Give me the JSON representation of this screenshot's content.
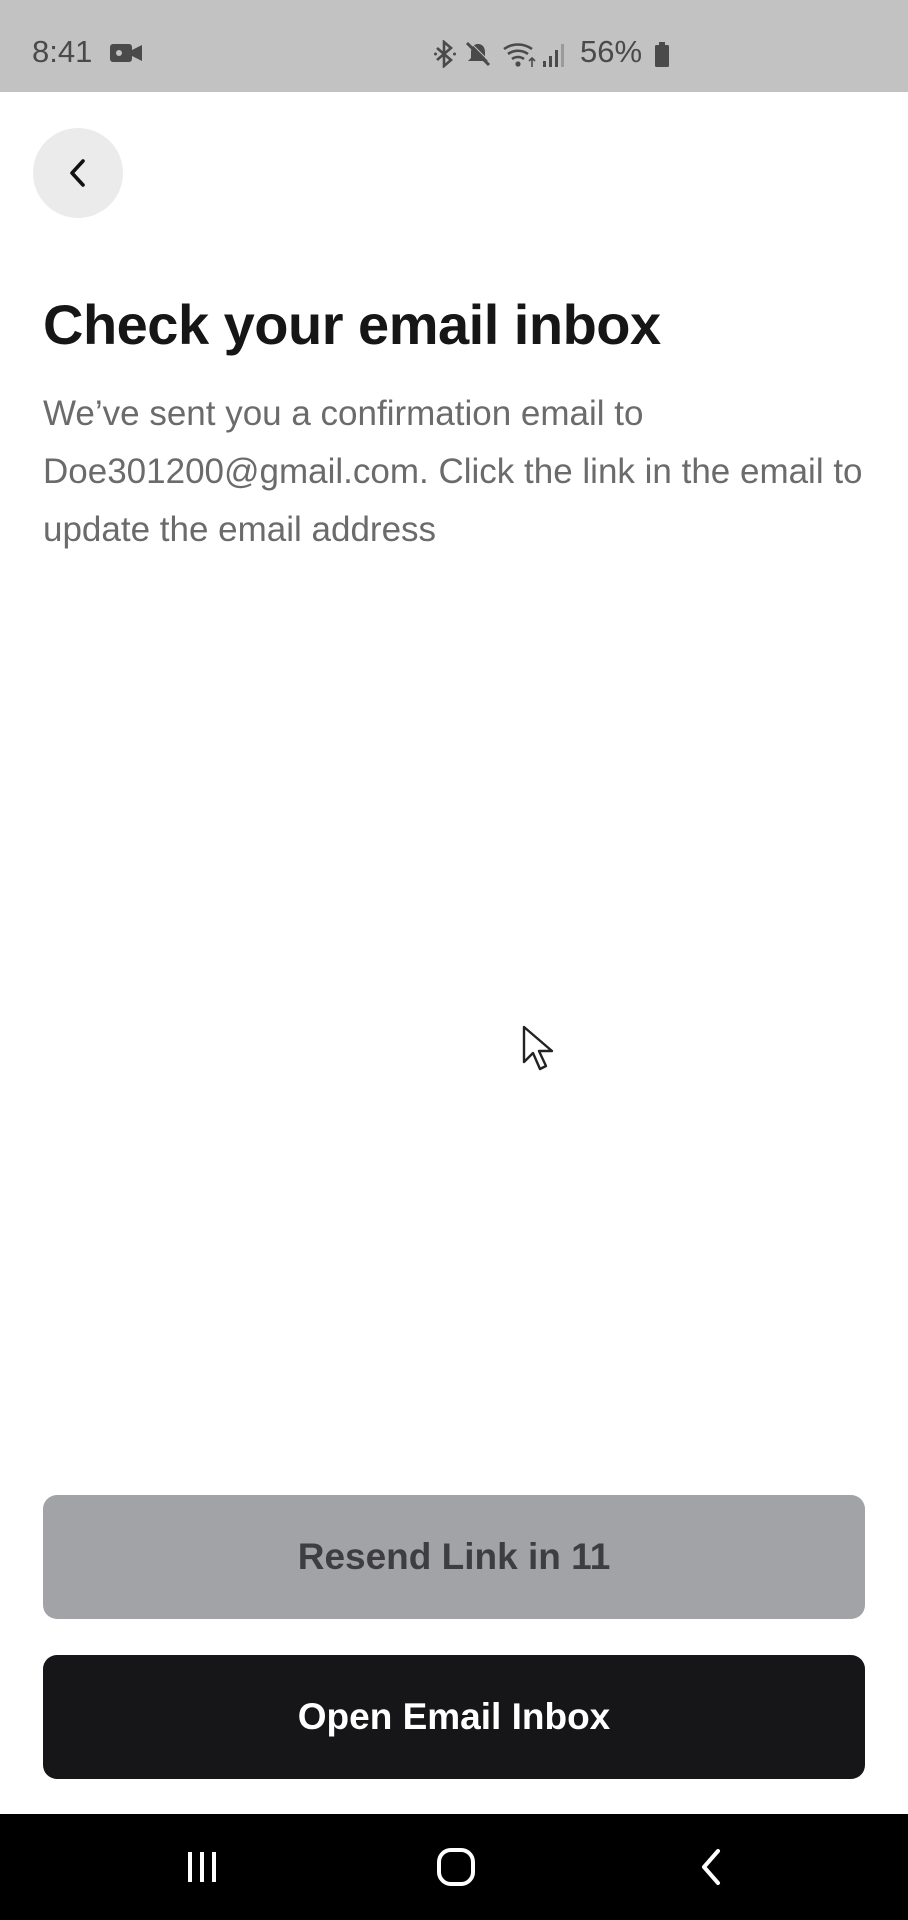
{
  "status_bar": {
    "time": "8:41",
    "battery": "56%",
    "icons": [
      "video-icon",
      "bluetooth-icon",
      "mute-icon",
      "wifi-icon",
      "signal-icon",
      "battery-icon"
    ]
  },
  "header": {
    "back_icon": "chevron-left-icon"
  },
  "main": {
    "title": "Check your email inbox",
    "description": "We’ve sent you a confirmation email to Doe301200@gmail.com. Click the link in the email to update the email address"
  },
  "actions": {
    "resend_label": "Resend Link in 11",
    "open_inbox_label": "Open Email Inbox"
  },
  "nav_bar": {
    "icons": [
      "recents-icon",
      "home-icon",
      "back-icon"
    ]
  },
  "colors": {
    "status_bar_bg": "#c2c2c2",
    "resend_button_bg": "#a2a3a7",
    "primary_button_bg": "#161618",
    "title_text": "#161616",
    "body_text": "#6b6b6b"
  }
}
